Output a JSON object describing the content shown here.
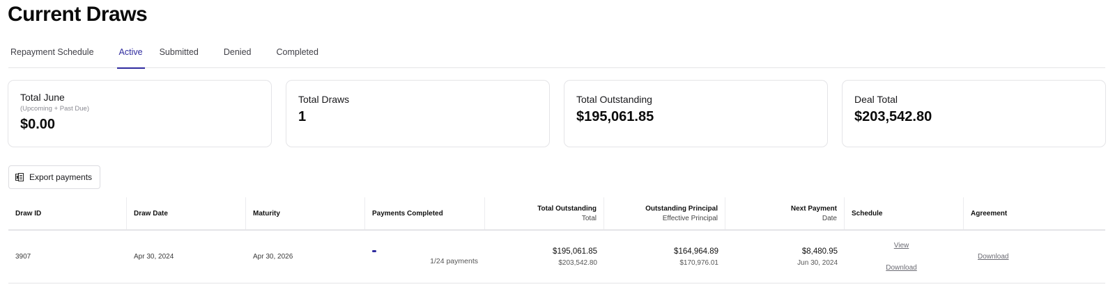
{
  "page": {
    "title": "Current Draws"
  },
  "tabs": [
    {
      "label": "Repayment Schedule",
      "active": false
    },
    {
      "label": "Active",
      "active": true
    },
    {
      "label": "Submitted",
      "active": false
    },
    {
      "label": "Denied",
      "active": false
    },
    {
      "label": "Completed",
      "active": false
    }
  ],
  "accent_color": "#2e2a9e",
  "cards": [
    {
      "title": "Total June",
      "subtitle": "(Upcoming + Past Due)",
      "value": "$0.00"
    },
    {
      "title": "Total Draws",
      "value": "1"
    },
    {
      "title": "Total Outstanding",
      "value": "$195,061.85"
    },
    {
      "title": "Deal Total",
      "value": "$203,542.80"
    }
  ],
  "export": {
    "label": "Export payments",
    "icon": "spreadsheet-icon"
  },
  "table": {
    "headers": [
      {
        "label": "Draw ID"
      },
      {
        "label": "Draw Date"
      },
      {
        "label": "Maturity"
      },
      {
        "label": "Payments Completed"
      },
      {
        "label": "Total Outstanding",
        "sub": "Total"
      },
      {
        "label": "Outstanding Principal",
        "sub": "Effective Principal"
      },
      {
        "label": "Next Payment",
        "sub": "Date"
      },
      {
        "label": "Schedule"
      },
      {
        "label": "Agreement"
      }
    ],
    "rows": [
      {
        "draw_id": "3907",
        "draw_date": "Apr 30, 2024",
        "maturity": "Apr 30, 2026",
        "payments_completed": {
          "text": "1/24 payments",
          "fraction": 0.0417
        },
        "total_outstanding": "$195,061.85",
        "total": "$203,542.80",
        "outstanding_principal": "$164,964.89",
        "effective_principal": "$170,976.01",
        "next_payment": "$8,480.95",
        "next_payment_date": "Jun 30, 2024",
        "schedule_view": "View",
        "schedule_download": "Download",
        "agreement_download": "Download"
      }
    ]
  }
}
